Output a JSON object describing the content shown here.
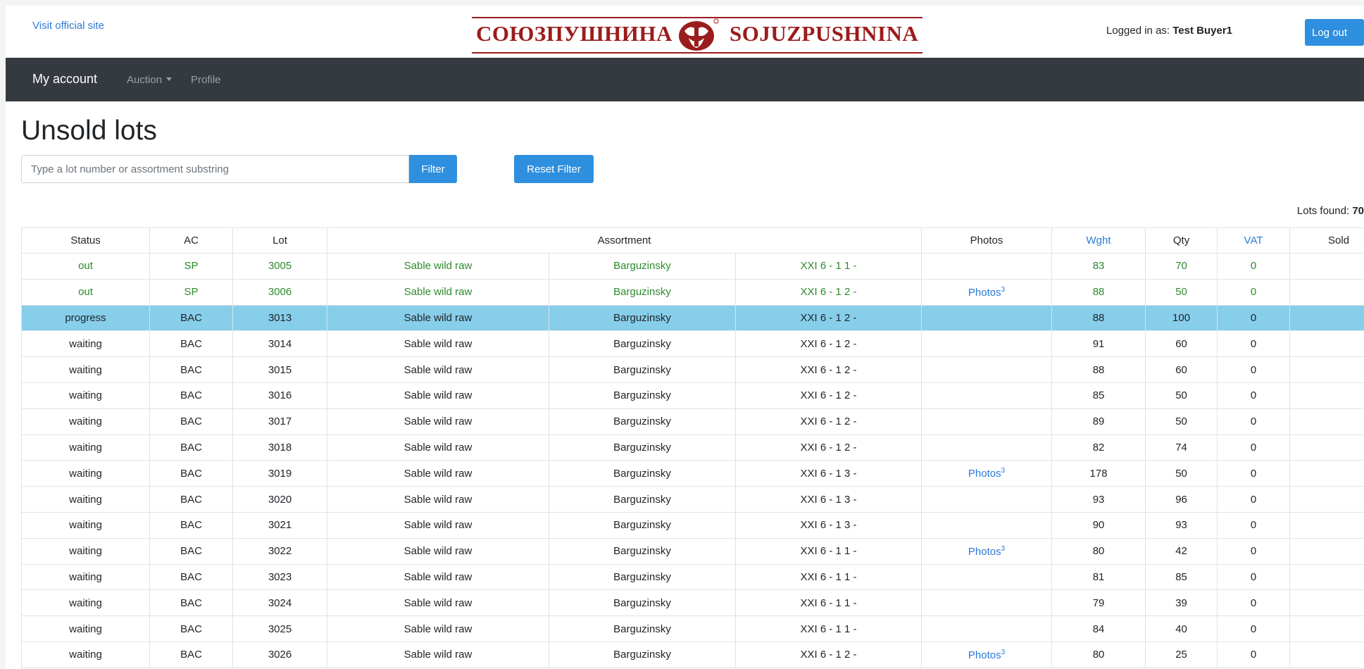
{
  "header": {
    "visit_link": "Visit official site",
    "logo_cyrillic": "СОЮЗПУШНИНА",
    "logo_latin": "SOJUZPUSHNINA",
    "logged_in_label": "Logged in as: ",
    "user_name": "Test Buyer1",
    "logout_label": "Log out"
  },
  "nav": {
    "brand": "My account",
    "auction": "Auction",
    "profile": "Profile"
  },
  "page": {
    "title": "Unsold lots",
    "search_placeholder": "Type a lot number or assortment substring",
    "search_value": "",
    "filter_label": "Filter",
    "reset_label": "Reset Filter",
    "lots_found_label": "Lots found: ",
    "lots_found_count": "70"
  },
  "colors": {
    "accent": "#2e8fde",
    "navbar": "#343a40",
    "highlight_row": "#87ceeb",
    "status_green": "#2d8a2d",
    "brand_red": "#9b1c1c"
  },
  "table": {
    "columns": [
      "Status",
      "AC",
      "Lot",
      "Assortment",
      "Photos",
      "Wght",
      "Qty",
      "VAT",
      "Sold"
    ],
    "rows": [
      {
        "status": "out",
        "ac": "SP",
        "lot": "3005",
        "a1": "Sable wild raw",
        "a2": "Barguzinsky",
        "a3": "XXI 6 - 1 1 -",
        "photos": "",
        "wght": "83",
        "qty": "70",
        "vat": "0",
        "sold": "",
        "style": "g"
      },
      {
        "status": "out",
        "ac": "SP",
        "lot": "3006",
        "a1": "Sable wild raw",
        "a2": "Barguzinsky",
        "a3": "XXI 6 - 1 2 -",
        "photos": "Photos",
        "wght": "88",
        "qty": "50",
        "vat": "0",
        "sold": "",
        "style": "g"
      },
      {
        "status": "progress",
        "ac": "BAC",
        "lot": "3013",
        "a1": "Sable wild raw",
        "a2": "Barguzinsky",
        "a3": "XXI 6 - 1 2 -",
        "photos": "",
        "wght": "88",
        "qty": "100",
        "vat": "0",
        "sold": "",
        "style": "hl"
      },
      {
        "status": "waiting",
        "ac": "BAC",
        "lot": "3014",
        "a1": "Sable wild raw",
        "a2": "Barguzinsky",
        "a3": "XXI 6 - 1 2 -",
        "photos": "",
        "wght": "91",
        "qty": "60",
        "vat": "0",
        "sold": "",
        "style": "d"
      },
      {
        "status": "waiting",
        "ac": "BAC",
        "lot": "3015",
        "a1": "Sable wild raw",
        "a2": "Barguzinsky",
        "a3": "XXI 6 - 1 2 -",
        "photos": "",
        "wght": "88",
        "qty": "60",
        "vat": "0",
        "sold": "",
        "style": "d"
      },
      {
        "status": "waiting",
        "ac": "BAC",
        "lot": "3016",
        "a1": "Sable wild raw",
        "a2": "Barguzinsky",
        "a3": "XXI 6 - 1 2 -",
        "photos": "",
        "wght": "85",
        "qty": "50",
        "vat": "0",
        "sold": "",
        "style": "d"
      },
      {
        "status": "waiting",
        "ac": "BAC",
        "lot": "3017",
        "a1": "Sable wild raw",
        "a2": "Barguzinsky",
        "a3": "XXI 6 - 1 2 -",
        "photos": "",
        "wght": "89",
        "qty": "50",
        "vat": "0",
        "sold": "",
        "style": "d"
      },
      {
        "status": "waiting",
        "ac": "BAC",
        "lot": "3018",
        "a1": "Sable wild raw",
        "a2": "Barguzinsky",
        "a3": "XXI 6 - 1 2 -",
        "photos": "",
        "wght": "82",
        "qty": "74",
        "vat": "0",
        "sold": "",
        "style": "d"
      },
      {
        "status": "waiting",
        "ac": "BAC",
        "lot": "3019",
        "a1": "Sable wild raw",
        "a2": "Barguzinsky",
        "a3": "XXI 6 - 1 3 -",
        "photos": "Photos",
        "wght": "178",
        "qty": "50",
        "vat": "0",
        "sold": "",
        "style": "d"
      },
      {
        "status": "waiting",
        "ac": "BAC",
        "lot": "3020",
        "a1": "Sable wild raw",
        "a2": "Barguzinsky",
        "a3": "XXI 6 - 1 3 -",
        "photos": "",
        "wght": "93",
        "qty": "96",
        "vat": "0",
        "sold": "",
        "style": "d"
      },
      {
        "status": "waiting",
        "ac": "BAC",
        "lot": "3021",
        "a1": "Sable wild raw",
        "a2": "Barguzinsky",
        "a3": "XXI 6 - 1 3 -",
        "photos": "",
        "wght": "90",
        "qty": "93",
        "vat": "0",
        "sold": "",
        "style": "d"
      },
      {
        "status": "waiting",
        "ac": "BAC",
        "lot": "3022",
        "a1": "Sable wild raw",
        "a2": "Barguzinsky",
        "a3": "XXI 6 - 1 1 -",
        "photos": "Photos",
        "wght": "80",
        "qty": "42",
        "vat": "0",
        "sold": "",
        "style": "d"
      },
      {
        "status": "waiting",
        "ac": "BAC",
        "lot": "3023",
        "a1": "Sable wild raw",
        "a2": "Barguzinsky",
        "a3": "XXI 6 - 1 1 -",
        "photos": "",
        "wght": "81",
        "qty": "85",
        "vat": "0",
        "sold": "",
        "style": "d"
      },
      {
        "status": "waiting",
        "ac": "BAC",
        "lot": "3024",
        "a1": "Sable wild raw",
        "a2": "Barguzinsky",
        "a3": "XXI 6 - 1 1 -",
        "photos": "",
        "wght": "79",
        "qty": "39",
        "vat": "0",
        "sold": "",
        "style": "d"
      },
      {
        "status": "waiting",
        "ac": "BAC",
        "lot": "3025",
        "a1": "Sable wild raw",
        "a2": "Barguzinsky",
        "a3": "XXI 6 - 1 1 -",
        "photos": "",
        "wght": "84",
        "qty": "40",
        "vat": "0",
        "sold": "",
        "style": "d"
      },
      {
        "status": "waiting",
        "ac": "BAC",
        "lot": "3026",
        "a1": "Sable wild raw",
        "a2": "Barguzinsky",
        "a3": "XXI 6 - 1 2 -",
        "photos": "Photos",
        "wght": "80",
        "qty": "25",
        "vat": "0",
        "sold": "",
        "style": "d"
      }
    ],
    "photos_count_sup": "3"
  }
}
